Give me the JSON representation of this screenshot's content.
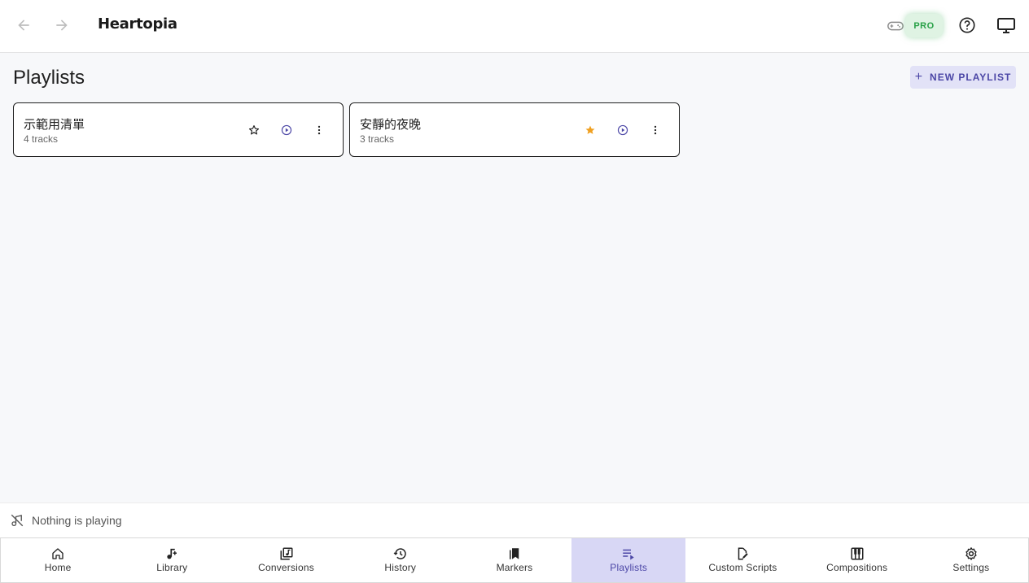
{
  "header": {
    "title": "Heartopia",
    "pro_label": "PRO"
  },
  "main": {
    "title": "Playlists",
    "new_playlist_label": "NEW PLAYLIST",
    "new_playlist_icon": "+"
  },
  "playlists": [
    {
      "name": "示範用清單",
      "count": "4 tracks",
      "favorite": false
    },
    {
      "name": "安靜的夜晚",
      "count": "3 tracks",
      "favorite": true
    }
  ],
  "player": {
    "status": "Nothing is playing"
  },
  "bottom_nav": [
    {
      "label": "Home",
      "icon": "home-icon"
    },
    {
      "label": "Library",
      "icon": "music-note-add-icon"
    },
    {
      "label": "Conversions",
      "icon": "library-music-icon"
    },
    {
      "label": "History",
      "icon": "history-icon"
    },
    {
      "label": "Markers",
      "icon": "bookmarks-icon"
    },
    {
      "label": "Playlists",
      "icon": "playlist-play-icon",
      "active": true
    },
    {
      "label": "Custom Scripts",
      "icon": "edit-document-icon"
    },
    {
      "label": "Compositions",
      "icon": "piano-icon"
    },
    {
      "label": "Settings",
      "icon": "gear-icon"
    }
  ],
  "colors": {
    "accent": "#4b46a6",
    "active_nav_bg": "#d8d7f5",
    "favorite_star": "#f0a020",
    "pro_green": "#27a046"
  }
}
